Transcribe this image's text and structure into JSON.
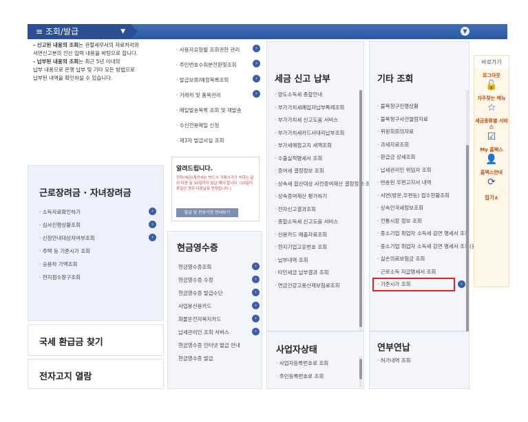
{
  "topbar": {
    "menu_label": "조회/발급",
    "menu_icon": "≡"
  },
  "notice": {
    "lines": [
      {
        "bold": "- 신고된 내용의 조회",
        "text": "는 관할세무서의 자료처리와"
      },
      {
        "bold": "",
        "text": "서면신고분의 전산 입력 내용을 바탕으로 합니다."
      },
      {
        "bold": "- 납부된 내용의 조회",
        "text": "는 최근 5년 이내의"
      },
      {
        "bold": "",
        "text": "납부 내용으로 은행 납부 및 기타 모든 방법으로"
      },
      {
        "bold": "",
        "text": "납부된 내역을 확인하실 수 있습니다."
      }
    ]
  },
  "col2_top": {
    "items": [
      "· 사용자유형별 조회권한 관리",
      "· 주민번호수취분전환및조회",
      "· 발급보류/예정목록조회",
      "· 거래처 및 품목관리",
      "· 메일발송목록 조회 및 재발송",
      "· 수신전용메일 신청",
      "· 제3자 발급사실 조회"
    ]
  },
  "alert": {
    "title": "알려드립니다.",
    "body": "전자(세금)계산서는 반드시 거래시기가 속하는 달의 다음 달 10일까지 발급 해야 합니다. (10일이 휴일인 경우 다음날로 연장됩니다.)",
    "button": "발급 및 전송기한 안내보기"
  },
  "tax_payment": {
    "title": "세금 신고 납부",
    "items": [
      "· 양도소득세 종합안내",
      "· 부가가치세예입자납부특례조회",
      "· 부가가치세 신고도움 서비스",
      "· 부가가치세카드사대리납부조회",
      "· 부가세예정고지 세액조회",
      "· 수출실적명세서 조회",
      "· 증여세 결정정보 조회",
      "· 상속세 합산대상 사전증여재산 결정정보 조회",
      "· 상속증여재산 평가하기",
      "· 전자신고결과조회",
      "· 종합소득세 신고도움 서비스",
      "· 신용카드 매출자료조회",
      "· 현지기업고유번호 조회",
      "· 납부내역 조회",
      "· 타인세금 납부결과 조회",
      "· 연금건강고용산재보험료조회"
    ]
  },
  "other": {
    "title": "기타 조회",
    "items": [
      "· 불복청구진행상황",
      "· 불복청구사건열람자료",
      "· 위원회회의자료",
      "· 과세자료조회",
      "· 환급금 상세조회",
      "· 납세관리인 위임자 조회",
      "· 반송된 우편고지서 내역",
      "· 서면(방문,우편등) 접수현황조회",
      "· 상속인국세정보조회",
      "· 전통시장 정보 조회",
      "· 중소기업 취업자 소득세 감면 명세서 조회",
      "· 중소기업 취업자 소득세 감면 명세서 조회(원천징수의무자)",
      "· 실손의료보험금 조회",
      "· 근로소득 지급명세서 조회",
      "· 기준시가 조회"
    ]
  },
  "earned_credit": {
    "title": "근로장려금 · 자녀장려금",
    "items": [
      "· 소득자료확인하기",
      "· 심사진행상황조회",
      "· 신청안내대상자여부조회",
      "· 주택 등 기준시가 조회",
      "· 승용차 가액조회",
      "· 현지점수창구조회"
    ]
  },
  "cash_receipt": {
    "title": "현금영수증",
    "items": [
      "현금영수증조회",
      "현금영수증 수정",
      "현금영수증 발급수단",
      "사업용신용카드",
      "화물운전자복지카드",
      "납세관리인 조회 서비스",
      "현금영수증 인터넷 발급 안내",
      "현금영수증 발급"
    ]
  },
  "refund": {
    "title": "국세 환급금 찾기"
  },
  "e_notice": {
    "title": "전자고지 열람"
  },
  "business_status": {
    "title": "사업자상태",
    "items": [
      "· 사업자등록번호로 조회",
      "· 주민등록번호로 조회"
    ]
  },
  "pension": {
    "title": "연부연납",
    "items": [
      "· 허가내역 조회"
    ]
  },
  "quick_menu": {
    "head": "바로가기",
    "items": [
      {
        "label": "로그아웃",
        "icon": "lock-icon"
      },
      {
        "label": "자주찾는 메뉴",
        "icon": "star-icon"
      },
      {
        "label": "세금종류별 서비스",
        "icon": "check-icon"
      },
      {
        "label": "My 홈택스",
        "icon": "user-icon"
      },
      {
        "label": "홈택스안내",
        "icon": "refresh-icon"
      }
    ],
    "close": "접기∧"
  }
}
